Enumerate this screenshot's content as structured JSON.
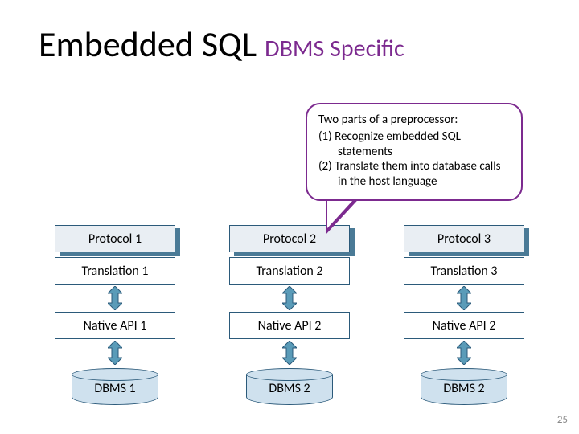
{
  "title": {
    "main": "Embedded SQL",
    "sub": "DBMS Specific"
  },
  "callout": {
    "heading": "Two parts of a preprocessor:",
    "items": [
      "(1)  Recognize embedded SQL statements",
      "(2)  Translate them into database calls in the host language"
    ]
  },
  "columns": [
    {
      "protocol": "Protocol 1",
      "translation": "Translation 1",
      "native": "Native API 1",
      "dbms": "DBMS 1"
    },
    {
      "protocol": "Protocol 2",
      "translation": "Translation 2",
      "native": "Native API 2",
      "dbms": "DBMS 2"
    },
    {
      "protocol": "Protocol 3",
      "translation": "Translation 3",
      "native": "Native API 2",
      "dbms": "DBMS 2"
    }
  ],
  "page_number": "25",
  "colors": {
    "accent": "#7c2a8f",
    "box_border": "#2b5a7a",
    "cyl_fill": "#cfe1ee",
    "arrow_fill": "#5a9bb8"
  }
}
